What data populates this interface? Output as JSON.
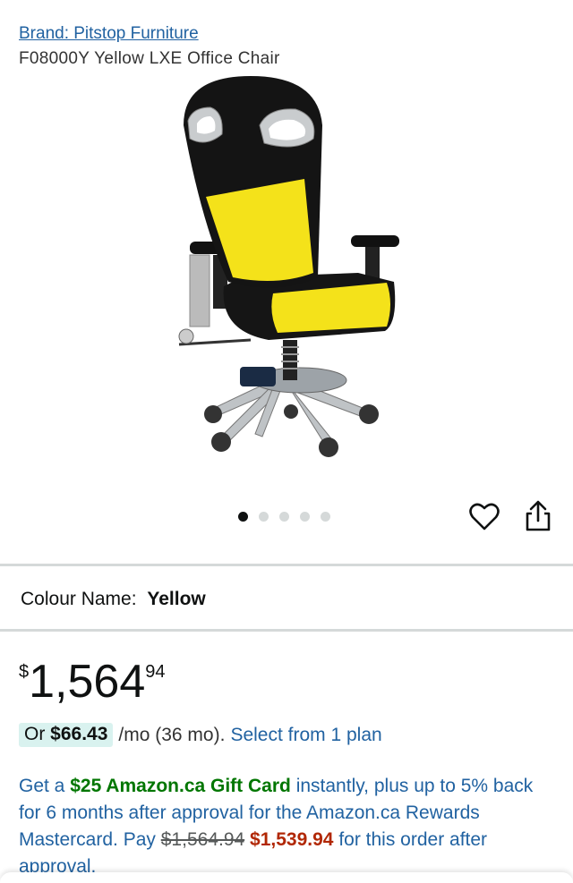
{
  "brand": {
    "label": "Brand: Pitstop Furniture"
  },
  "product": {
    "title": "F08000Y Yellow LXE Office Chair"
  },
  "gallery": {
    "image_count": 5,
    "active_index": 0
  },
  "actions": {
    "wishlist_icon": "heart-icon",
    "share_icon": "share-icon"
  },
  "colour": {
    "label": "Colour Name:",
    "value": "Yellow"
  },
  "price": {
    "symbol": "$",
    "whole": "1,564",
    "fraction": "94"
  },
  "monthly": {
    "prefix": "Or",
    "amount": "$66.43",
    "term": "/mo (36 mo).",
    "link": "Select from 1 plan"
  },
  "promo": {
    "text1": "Get a",
    "gift": "$25 Amazon.ca Gift Card",
    "text2": "instantly, plus up to 5% back for 6 months after approval for the Amazon.ca Rewards Mastercard.",
    "pay": "Pay",
    "old_price": "$1,564.94",
    "new_price": "$1,539.94",
    "text3": "for this order after approval."
  },
  "colors": {
    "link": "#2162a1",
    "green": "#007600",
    "red": "#b12704",
    "pill": "#d9f2ef"
  }
}
